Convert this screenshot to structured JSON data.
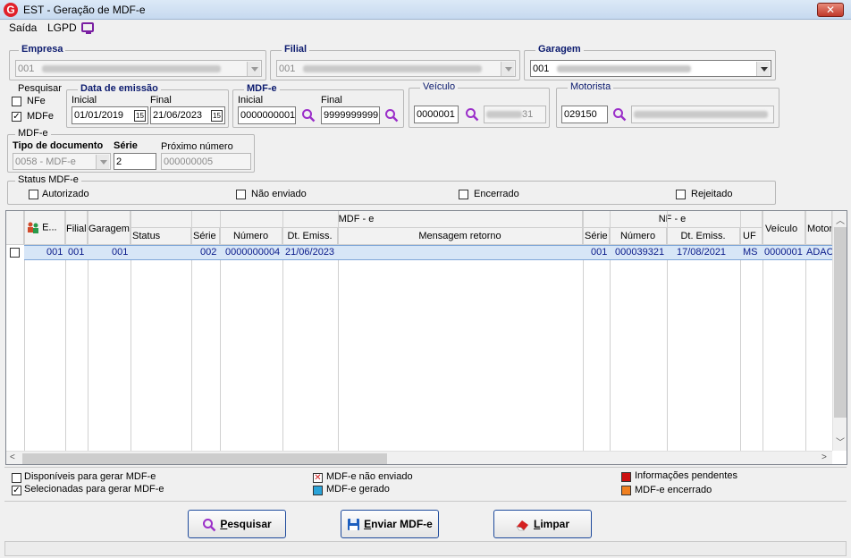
{
  "window": {
    "title": "EST - Geração de MDF-e",
    "logo": "G",
    "close": "✕"
  },
  "menu": {
    "saida": "Saída",
    "lgpd": "LGPD"
  },
  "empresa": {
    "title": "Empresa",
    "value": "001"
  },
  "filial": {
    "title": "Filial",
    "value": "001"
  },
  "garagem": {
    "title": "Garagem",
    "value": "001"
  },
  "pesquisar": {
    "title": "Pesquisar",
    "nfe": "NFe",
    "mdfe": "MDFe",
    "nfe_checked": false,
    "mdfe_checked": true
  },
  "data_emissao": {
    "title": "Data de emissão",
    "inicial_label": "Inicial",
    "final_label": "Final",
    "inicial": "01/01/2019",
    "final": "21/06/2023",
    "cal": "15"
  },
  "mdfe_range": {
    "title": "MDF-e",
    "inicial_label": "Inicial",
    "final_label": "Final",
    "inicial": "0000000001",
    "final": "9999999999"
  },
  "veiculo": {
    "title": "Veículo",
    "value": "0000001",
    "desc_suffix": "31"
  },
  "motorista": {
    "title": "Motorista",
    "value": "029150"
  },
  "mdfe_box": {
    "title": "MDF-e",
    "tipo_label": "Tipo de documento",
    "serie_label": "Série",
    "proximo_label": "Próximo número",
    "tipo_value": "0058 - MDF-e",
    "serie_value": "2",
    "proximo_value": "000000005"
  },
  "status": {
    "title": "Status MDF-e",
    "autorizado": "Autorizado",
    "nao_enviado": "Não enviado",
    "encerrado": "Encerrado",
    "rejeitado": "Rejeitado"
  },
  "grid": {
    "group_mdfe": "MDF - e",
    "group_nfe": "NF - e",
    "headers": {
      "e": "E...",
      "filial": "Filial",
      "garagem": "Garagem",
      "status": "Status",
      "serie": "Série",
      "numero": "Número",
      "dt_emiss": "Dt. Emiss.",
      "mensagem": "Mensagem retorno",
      "nf_serie": "Série",
      "nf_numero": "Número",
      "nf_dt_emiss": "Dt. Emiss.",
      "uf": "UF",
      "veiculo": "Veículo",
      "motorista": "Motori"
    },
    "rows": [
      {
        "e": "001",
        "filial": "001",
        "garagem": "001",
        "status": "",
        "serie": "002",
        "numero": "0000000004",
        "dt_emiss": "21/06/2023",
        "mensagem": "",
        "nf_serie": "001",
        "nf_numero": "000039321",
        "nf_dt_emiss": "17/08/2021",
        "uf": "MS",
        "veiculo": "0000001",
        "motorista": "ADAC"
      }
    ]
  },
  "legend": {
    "disponiveis": "Disponíveis para gerar MDF-e",
    "selecionadas": "Selecionadas para gerar MDF-e",
    "nao_enviado": "MDF-e não enviado",
    "gerado": "MDF-e gerado",
    "pendentes": "Informações pendentes",
    "encerrado": "MDF-e encerrado",
    "colors": {
      "nao_enviado": "#d42020",
      "gerado": "#2aa3d8",
      "pendentes": "#cc1010",
      "encerrado": "#f08020"
    }
  },
  "buttons": {
    "pesquisar_u": "P",
    "pesquisar_rest": "esquisar",
    "enviar_u": "E",
    "enviar_rest": "nviar MDF-e",
    "limpar_u": "L",
    "limpar_rest": "impar"
  }
}
